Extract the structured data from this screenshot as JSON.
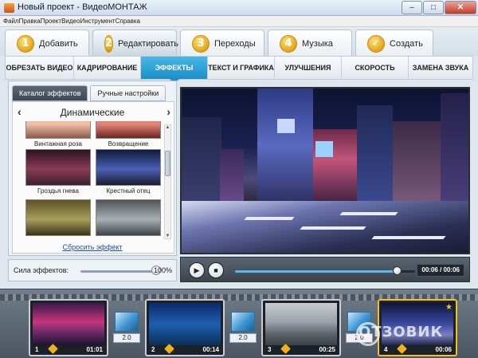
{
  "window": {
    "title": "Новый проект - ВидеоМОНТАЖ",
    "min": "–",
    "max": "□",
    "close": "✕"
  },
  "menu": {
    "items": [
      "Файл",
      "Правка",
      "Проект",
      "Видео",
      "Инструмент",
      "Справка"
    ]
  },
  "steps": [
    {
      "num": "1",
      "label": "Добавить"
    },
    {
      "num": "2",
      "label": "Редактировать"
    },
    {
      "num": "3",
      "label": "Переходы"
    },
    {
      "num": "4",
      "label": "Музыка"
    },
    {
      "num": "✓",
      "label": "Создать"
    }
  ],
  "func_tabs": [
    "ОБРЕЗАТЬ ВИДЕО",
    "КАДРИРОВАНИЕ",
    "ЭФФЕКТЫ",
    "ТЕКСТ И ГРАФИКА",
    "УЛУЧШЕНИЯ",
    "СКОРОСТЬ",
    "ЗАМЕНА ЗВУКА"
  ],
  "active_func_tab": "ЭФФЕКТЫ",
  "effects_panel": {
    "tabs": [
      "Каталог эффектов",
      "Ручные настройки"
    ],
    "category": "Динамические",
    "prev": "‹",
    "next": "›",
    "effects": [
      {
        "name": "Винтажная роза"
      },
      {
        "name": "Возвращение"
      },
      {
        "name": "Гроздья гнева"
      },
      {
        "name": "Крестный отец"
      },
      {
        "name": ""
      },
      {
        "name": ""
      }
    ],
    "reset_label": "Сбросить эффект"
  },
  "strength": {
    "label": "Сила эффектов:",
    "value": "100%",
    "level": 1.0
  },
  "player": {
    "time": "00:06 / 00:06",
    "progress": 1.0
  },
  "timeline": {
    "clips": [
      {
        "num": "1",
        "duration": "01:01"
      },
      {
        "num": "2",
        "duration": "00:14"
      },
      {
        "num": "3",
        "duration": "00:25"
      },
      {
        "num": "4",
        "duration": "00:06"
      }
    ],
    "transitions": [
      "2.0",
      "2.0",
      "2.0"
    ]
  },
  "watermark": "ОТЗОВИК",
  "colors": {
    "accent": "#1b8fc7",
    "step_badge": "#e3a514",
    "selected_clip": "#f2c218"
  }
}
